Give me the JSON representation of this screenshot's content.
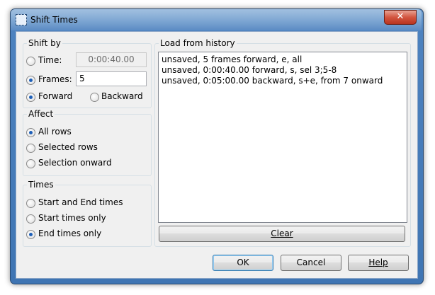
{
  "window": {
    "title": "Shift Times",
    "close_label": "✕"
  },
  "shift_by": {
    "title": "Shift by",
    "time_label": "Time:",
    "time_value": "0:00:40.00",
    "frames_label": "Frames:",
    "frames_value": "5",
    "forward_label": "Forward",
    "backward_label": "Backward",
    "selected_mode": "frames",
    "selected_direction": "forward"
  },
  "affect": {
    "title": "Affect",
    "options": [
      "All rows",
      "Selected rows",
      "Selection onward"
    ],
    "selected": "All rows"
  },
  "times": {
    "title": "Times",
    "options": [
      "Start and End times",
      "Start times only",
      "End times only"
    ],
    "selected": "End times only"
  },
  "history": {
    "title": "Load from history",
    "items": [
      "unsaved, 5 frames forward, e, all",
      "unsaved, 0:00:40.00 forward, s, sel 3;5-8",
      "unsaved, 0:05:00.00 backward, s+e, from 7 onward"
    ],
    "clear_label": "Clear"
  },
  "buttons": {
    "ok": "OK",
    "cancel": "Cancel",
    "help": "Help"
  },
  "colors": {
    "frame": "#4d82bf",
    "client": "#f0f0f0",
    "radio_dot": "#1d5fb8",
    "close": "#d2553f"
  }
}
